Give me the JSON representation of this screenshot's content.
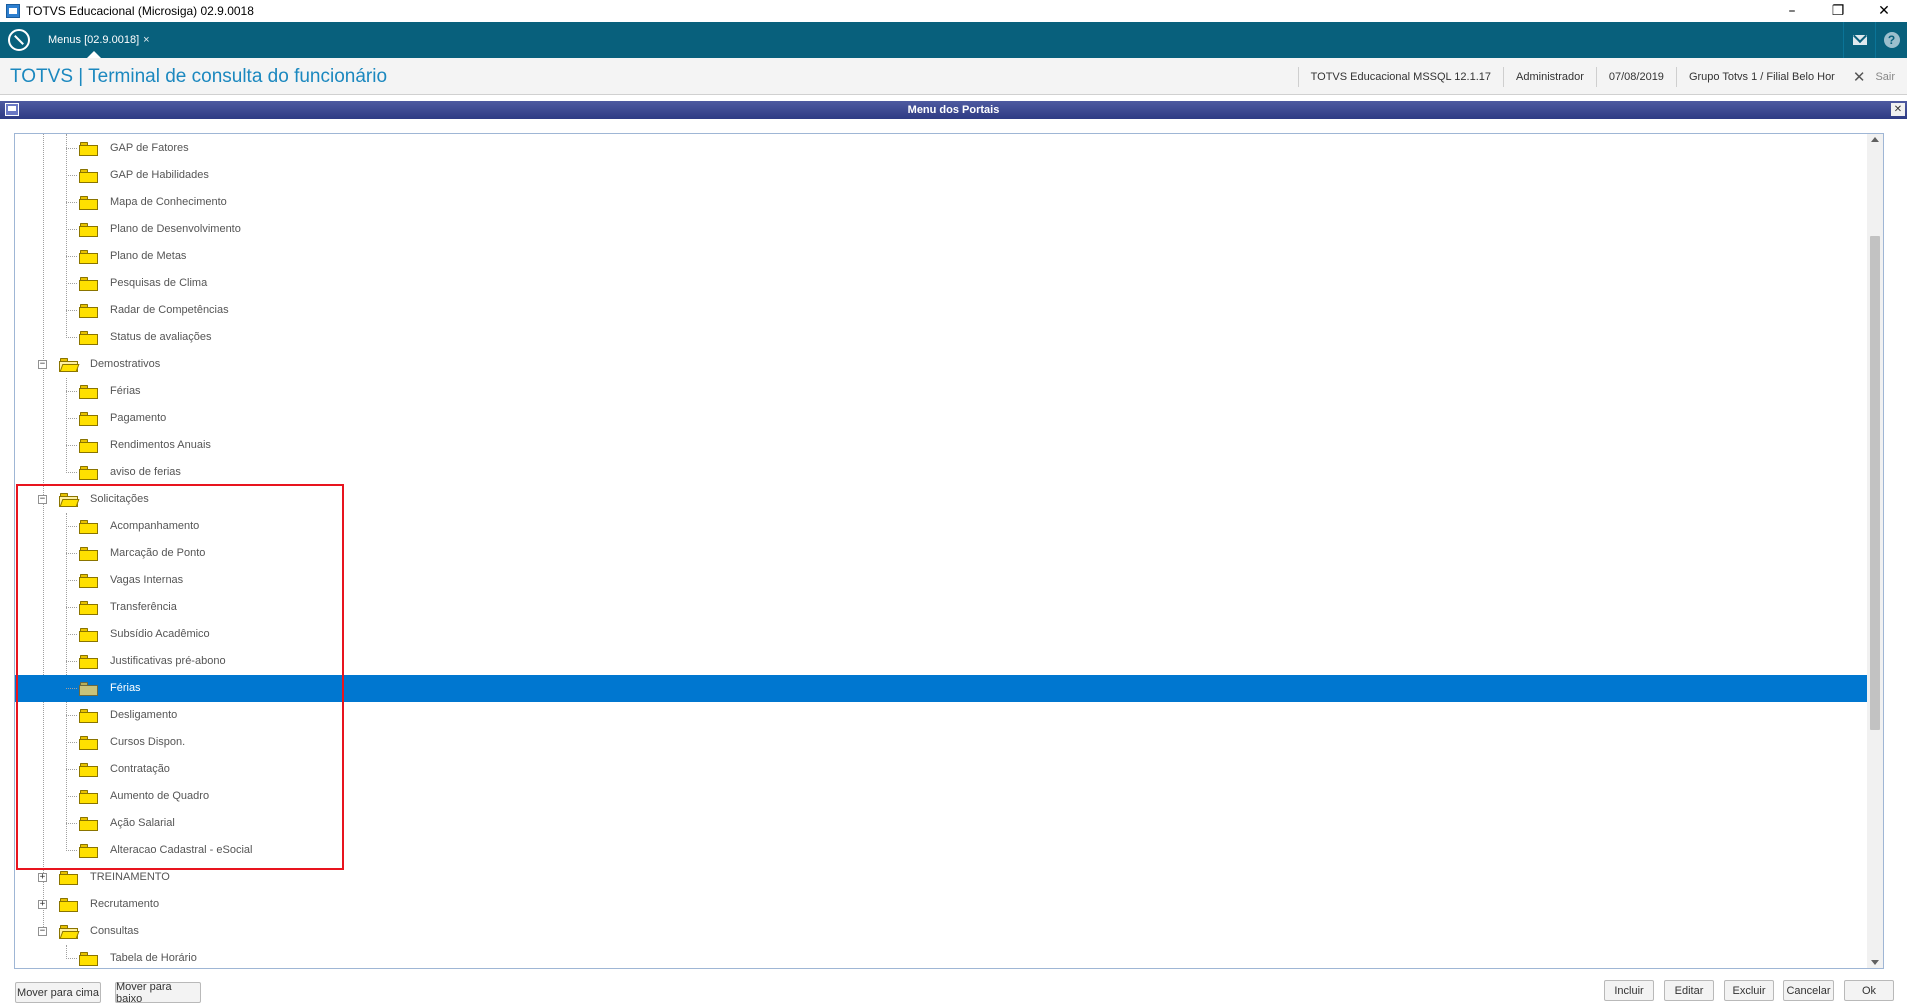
{
  "window": {
    "title": "TOTVS Educacional (Microsiga) 02.9.0018",
    "min": "–",
    "restore": "❐",
    "close": "✕"
  },
  "tabbar": {
    "tab_label": "Menus [02.9.0018]",
    "tab_close": "×",
    "help": "?"
  },
  "header": {
    "title": "TOTVS | Terminal de consulta do funcionário",
    "environment": "TOTVS Educacional MSSQL 12.1.17",
    "user": "Administrador",
    "date": "07/08/2019",
    "branch": "Grupo Totvs 1 / Filial Belo Hor",
    "exit_label": "Sair",
    "exit_icon": "✕"
  },
  "dialog": {
    "title": "Menu dos Portais",
    "close": "✕"
  },
  "tree": {
    "rows": [
      {
        "label": "GAP de Fatores",
        "level": 2
      },
      {
        "label": "GAP de Habilidades",
        "level": 2
      },
      {
        "label": "Mapa de Conhecimento",
        "level": 2
      },
      {
        "label": "Plano de Desenvolvimento",
        "level": 2
      },
      {
        "label": "Plano de Metas",
        "level": 2
      },
      {
        "label": "Pesquisas de Clima",
        "level": 2
      },
      {
        "label": "Radar de Competências",
        "level": 2
      },
      {
        "label": "Status de avaliações",
        "level": 2
      },
      {
        "label": "Demostrativos",
        "level": 1,
        "expanded": true
      },
      {
        "label": "Férias",
        "level": 2
      },
      {
        "label": "Pagamento",
        "level": 2
      },
      {
        "label": "Rendimentos Anuais",
        "level": 2
      },
      {
        "label": "aviso de ferias",
        "level": 2
      },
      {
        "label": "Solicitações",
        "level": 1,
        "expanded": true
      },
      {
        "label": "Acompanhamento",
        "level": 2
      },
      {
        "label": "Marcação de Ponto",
        "level": 2
      },
      {
        "label": "Vagas Internas",
        "level": 2
      },
      {
        "label": "Transferência",
        "level": 2
      },
      {
        "label": "Subsídio Acadêmico",
        "level": 2
      },
      {
        "label": "Justificativas pré-abono",
        "level": 2
      },
      {
        "label": "Férias",
        "level": 2,
        "selected": true
      },
      {
        "label": "Desligamento",
        "level": 2
      },
      {
        "label": "Cursos Dispon.",
        "level": 2
      },
      {
        "label": "Contratação",
        "level": 2
      },
      {
        "label": "Aumento de Quadro",
        "level": 2
      },
      {
        "label": "Ação Salarial",
        "level": 2
      },
      {
        "label": "Alteracao Cadastral - eSocial",
        "level": 2
      },
      {
        "label": "TREINAMENTO",
        "level": 1,
        "expanded": false
      },
      {
        "label": "Recrutamento",
        "level": 1,
        "expanded": false
      },
      {
        "label": "Consultas",
        "level": 1,
        "expanded": true
      },
      {
        "label": "Tabela de Horário",
        "level": 2
      }
    ]
  },
  "buttons": {
    "move_up": "Mover para cima",
    "move_down": "Mover para baixo",
    "include": "Incluir",
    "edit": "Editar",
    "delete": "Excluir",
    "cancel": "Cancelar",
    "ok": "Ok"
  },
  "colors": {
    "accent": "#08607c",
    "title_blue": "#1b88bf",
    "selection": "#0077d0",
    "highlight_box": "#e8141e"
  }
}
